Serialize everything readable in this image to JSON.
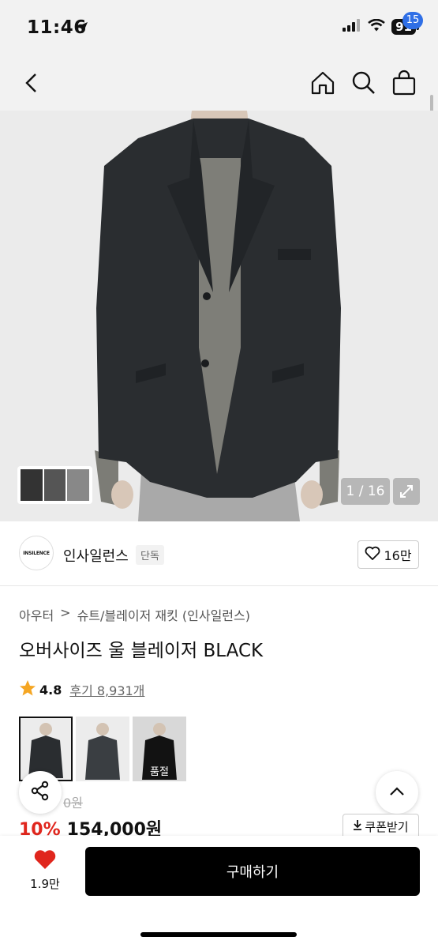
{
  "status": {
    "time": "11:46",
    "battery": "91"
  },
  "nav": {
    "cart_count": "15"
  },
  "gallery": {
    "counter": "1 / 16"
  },
  "brand": {
    "name": "인사일런스",
    "logo_text": "INSILENCE",
    "tag": "단독",
    "likes": "16만"
  },
  "breadcrumb": {
    "level1": "아우터",
    "separator": ">",
    "level2": "슈트/블레이저 재킷 (인사일런스)"
  },
  "product": {
    "title": "오버사이즈 울 블레이저 BLACK",
    "rating": "4.8",
    "reviews": "후기 8,931개",
    "variants": [
      {
        "sold_label": ""
      },
      {
        "sold_label": ""
      },
      {
        "sold_label": "품절"
      }
    ],
    "original_price": "0원",
    "discount": "10%",
    "price": "154,000원",
    "coupon_label": "쿠폰받기"
  },
  "bottom": {
    "wish_count": "1.9만",
    "buy_label": "구매하기"
  },
  "colors": {
    "accent_red": "#e0261d",
    "badge_blue": "#2f6fe6",
    "buy_bg": "#000000"
  }
}
